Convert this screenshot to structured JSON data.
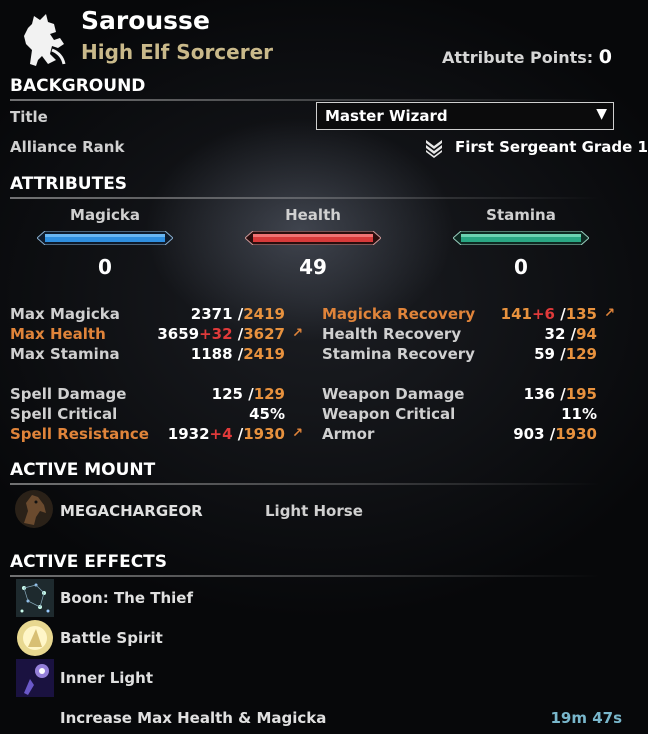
{
  "header": {
    "icon": "rampant-lion-icon",
    "name": "Sarousse",
    "subtitle": "High Elf Sorcerer",
    "attribute_points_label": "Attribute Points:",
    "attribute_points": "0"
  },
  "background": {
    "heading": "BACKGROUND",
    "title_label": "Title",
    "title_value": "Master Wizard",
    "alliance_rank_label": "Alliance Rank",
    "alliance_rank_value": "First Sergeant Grade 1",
    "rank_icon": "chevron-rank-icon"
  },
  "attributes": {
    "heading": "ATTRIBUTES",
    "items": [
      {
        "label": "Magicka",
        "value": "0",
        "color": "#3aa0e8"
      },
      {
        "label": "Health",
        "value": "49",
        "color": "#e04a4a"
      },
      {
        "label": "Stamina",
        "value": "0",
        "color": "#3ab08a"
      }
    ]
  },
  "stats": {
    "left": [
      {
        "name": "Max Magicka",
        "value": "2371",
        "bonus": "",
        "max": "2419",
        "highlight": false,
        "arrow": false
      },
      {
        "name": "Max Health",
        "value": "3659",
        "bonus": "+32",
        "max": "3627",
        "highlight": true,
        "arrow": true
      },
      {
        "name": "Max Stamina",
        "value": "1188",
        "bonus": "",
        "max": "2419",
        "highlight": false,
        "arrow": false
      },
      {
        "name": "Spell Damage",
        "value": "125",
        "bonus": "",
        "max": "129",
        "highlight": false,
        "arrow": false
      },
      {
        "name": "Spell Critical",
        "value": "45%",
        "bonus": "",
        "max": "",
        "highlight": false,
        "arrow": false
      },
      {
        "name": "Spell Resistance",
        "value": "1932",
        "bonus": "+4",
        "max": "1930",
        "highlight": true,
        "arrow": true
      }
    ],
    "right": [
      {
        "name": "Magicka Recovery",
        "value": "141",
        "bonus": "+6",
        "max": "135",
        "highlight": true,
        "arrow": true,
        "value_orange": true
      },
      {
        "name": "Health Recovery",
        "value": "32",
        "bonus": "",
        "max": "94",
        "highlight": false,
        "arrow": false
      },
      {
        "name": "Stamina Recovery",
        "value": "59",
        "bonus": "",
        "max": "129",
        "highlight": false,
        "arrow": false
      },
      {
        "name": "Weapon Damage",
        "value": "136",
        "bonus": "",
        "max": "195",
        "highlight": false,
        "arrow": false
      },
      {
        "name": "Weapon Critical",
        "value": "11%",
        "bonus": "",
        "max": "",
        "highlight": false,
        "arrow": false
      },
      {
        "name": "Armor",
        "value": "903",
        "bonus": "",
        "max": "1930",
        "highlight": false,
        "arrow": false
      }
    ]
  },
  "mount": {
    "heading": "ACTIVE MOUNT",
    "name": "MEGACHARGEOR",
    "type": "Light Horse",
    "icon": "horse-icon"
  },
  "effects": {
    "heading": "ACTIVE EFFECTS",
    "items": [
      {
        "name": "Boon: The Thief",
        "icon": "thief-boon-icon",
        "timer": ""
      },
      {
        "name": "Battle Spirit",
        "icon": "battle-spirit-icon",
        "timer": ""
      },
      {
        "name": "Inner Light",
        "icon": "inner-light-icon",
        "timer": ""
      },
      {
        "name": "Increase Max Health & Magicka",
        "icon": "",
        "timer": "19m 47s"
      }
    ]
  }
}
